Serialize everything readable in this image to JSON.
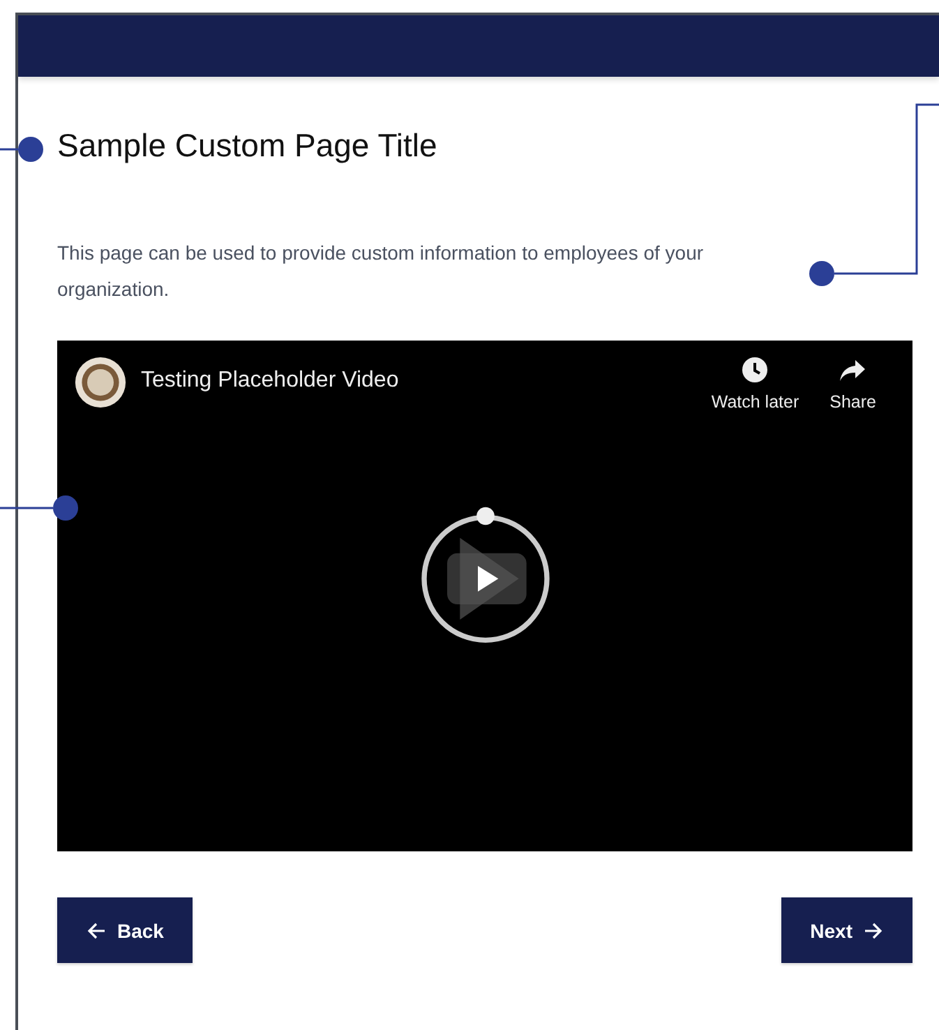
{
  "page": {
    "title": "Sample Custom Page Title",
    "description": "This page can be used to provide custom information to employees of your organization."
  },
  "video": {
    "title": "Testing Placeholder Video",
    "actions": [
      {
        "kind": "clock",
        "label": "Watch later"
      },
      {
        "kind": "share",
        "label": "Share"
      }
    ]
  },
  "buttons": [
    {
      "kind": "back",
      "label": "Back"
    },
    {
      "kind": "next",
      "label": "Next"
    }
  ]
}
